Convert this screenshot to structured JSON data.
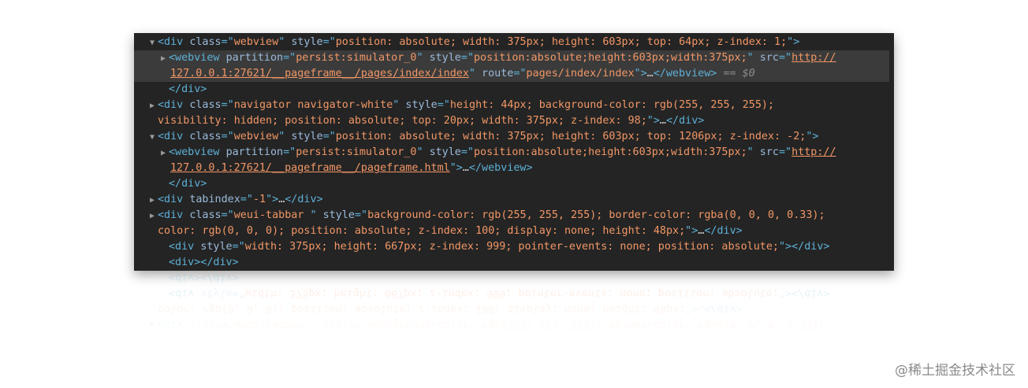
{
  "devtools": {
    "lines": [
      {
        "toggle": "▼",
        "segments": [
          {
            "cls": "tag",
            "text": "<div "
          },
          {
            "cls": "an",
            "text": "class"
          },
          {
            "cls": "tag",
            "text": "=\""
          },
          {
            "cls": "av",
            "text": "webview"
          },
          {
            "cls": "tag",
            "text": "\" "
          },
          {
            "cls": "an",
            "text": "style"
          },
          {
            "cls": "tag",
            "text": "=\""
          },
          {
            "cls": "av",
            "text": "position: absolute; width: 375px; height: 603px; top: 64px; z-index: 1;"
          },
          {
            "cls": "tag",
            "text": "\">"
          }
        ]
      },
      {
        "toggle": "▶",
        "segments": [
          {
            "cls": "tag",
            "text": "<webview "
          },
          {
            "cls": "an",
            "text": "partition"
          },
          {
            "cls": "tag",
            "text": "=\""
          },
          {
            "cls": "av",
            "text": "persist:simulator_0"
          },
          {
            "cls": "tag",
            "text": "\" "
          },
          {
            "cls": "an",
            "text": "style"
          },
          {
            "cls": "tag",
            "text": "=\""
          },
          {
            "cls": "av",
            "text": "position:absolute;height:603px;width:375px;"
          },
          {
            "cls": "tag",
            "text": "\" "
          },
          {
            "cls": "an",
            "text": "src"
          },
          {
            "cls": "tag",
            "text": "=\""
          },
          {
            "cls": "url",
            "text": "http://"
          }
        ]
      },
      {
        "toggle": "",
        "segments": [
          {
            "cls": "url",
            "text": "127.0.0.1:27621/__pageframe__/pages/index/index"
          },
          {
            "cls": "tag",
            "text": "\" "
          },
          {
            "cls": "an",
            "text": "route"
          },
          {
            "cls": "tag",
            "text": "=\""
          },
          {
            "cls": "av",
            "text": "pages/index/index"
          },
          {
            "cls": "tag",
            "text": "\">"
          },
          {
            "cls": "txt",
            "text": "…"
          },
          {
            "cls": "tag",
            "text": "</webview>"
          },
          {
            "cls": "dim",
            "text": " == $0"
          }
        ]
      },
      {
        "toggle": "",
        "segments": [
          {
            "cls": "tag",
            "text": "</div>"
          }
        ]
      },
      {
        "toggle": "▶",
        "segments": [
          {
            "cls": "tag",
            "text": "<div "
          },
          {
            "cls": "an",
            "text": "class"
          },
          {
            "cls": "tag",
            "text": "=\""
          },
          {
            "cls": "av",
            "text": "navigator navigator-white"
          },
          {
            "cls": "tag",
            "text": "\" "
          },
          {
            "cls": "an",
            "text": "style"
          },
          {
            "cls": "tag",
            "text": "=\""
          },
          {
            "cls": "av",
            "text": "height: 44px; background-color: rgb(255, 255, 255);"
          }
        ]
      },
      {
        "toggle": "",
        "segments": [
          {
            "cls": "av",
            "text": "visibility: hidden; position: absolute; top: 20px; width: 375px; z-index: 98;"
          },
          {
            "cls": "tag",
            "text": "\">"
          },
          {
            "cls": "txt",
            "text": "…"
          },
          {
            "cls": "tag",
            "text": "</div>"
          }
        ]
      },
      {
        "toggle": "▼",
        "segments": [
          {
            "cls": "tag",
            "text": "<div "
          },
          {
            "cls": "an",
            "text": "class"
          },
          {
            "cls": "tag",
            "text": "=\""
          },
          {
            "cls": "av",
            "text": "webview"
          },
          {
            "cls": "tag",
            "text": "\" "
          },
          {
            "cls": "an",
            "text": "style"
          },
          {
            "cls": "tag",
            "text": "=\""
          },
          {
            "cls": "av",
            "text": "position: absolute; width: 375px; height: 603px; top: 1206px; z-index: -2;"
          },
          {
            "cls": "tag",
            "text": "\">"
          }
        ]
      },
      {
        "toggle": "▶",
        "segments": [
          {
            "cls": "tag",
            "text": "<webview "
          },
          {
            "cls": "an",
            "text": "partition"
          },
          {
            "cls": "tag",
            "text": "=\""
          },
          {
            "cls": "av",
            "text": "persist:simulator_0"
          },
          {
            "cls": "tag",
            "text": "\" "
          },
          {
            "cls": "an",
            "text": "style"
          },
          {
            "cls": "tag",
            "text": "=\""
          },
          {
            "cls": "av",
            "text": "position:absolute;height:603px;width:375px;"
          },
          {
            "cls": "tag",
            "text": "\" "
          },
          {
            "cls": "an",
            "text": "src"
          },
          {
            "cls": "tag",
            "text": "=\""
          },
          {
            "cls": "url",
            "text": "http://"
          }
        ]
      },
      {
        "toggle": "",
        "segments": [
          {
            "cls": "url",
            "text": "127.0.0.1:27621/__pageframe__/pageframe.html"
          },
          {
            "cls": "tag",
            "text": "\">"
          },
          {
            "cls": "txt",
            "text": "…"
          },
          {
            "cls": "tag",
            "text": "</webview>"
          }
        ]
      },
      {
        "toggle": "",
        "segments": [
          {
            "cls": "tag",
            "text": "</div>"
          }
        ]
      },
      {
        "toggle": "▶",
        "segments": [
          {
            "cls": "tag",
            "text": "<div "
          },
          {
            "cls": "an",
            "text": "tabindex"
          },
          {
            "cls": "tag",
            "text": "=\""
          },
          {
            "cls": "av",
            "text": "-1"
          },
          {
            "cls": "tag",
            "text": "\">"
          },
          {
            "cls": "txt",
            "text": "…"
          },
          {
            "cls": "tag",
            "text": "</div>"
          }
        ]
      },
      {
        "toggle": "▶",
        "segments": [
          {
            "cls": "tag",
            "text": "<div "
          },
          {
            "cls": "an",
            "text": "class"
          },
          {
            "cls": "tag",
            "text": "=\""
          },
          {
            "cls": "av",
            "text": "weui-tabbar "
          },
          {
            "cls": "tag",
            "text": "\" "
          },
          {
            "cls": "an",
            "text": "style"
          },
          {
            "cls": "tag",
            "text": "=\""
          },
          {
            "cls": "av",
            "text": "background-color: rgb(255, 255, 255); border-color: rgba(0, 0, 0, 0.33);"
          }
        ]
      },
      {
        "toggle": "",
        "segments": [
          {
            "cls": "av",
            "text": "color: rgb(0, 0, 0); position: absolute; z-index: 100; display: none; height: 48px;"
          },
          {
            "cls": "tag",
            "text": "\">"
          },
          {
            "cls": "txt",
            "text": "…"
          },
          {
            "cls": "tag",
            "text": "</div>"
          }
        ]
      },
      {
        "toggle": "",
        "segments": [
          {
            "cls": "tag",
            "text": "<div "
          },
          {
            "cls": "an",
            "text": "style"
          },
          {
            "cls": "tag",
            "text": "=\""
          },
          {
            "cls": "av",
            "text": "width: 375px; height: 667px; z-index: 999; pointer-events: none; position: absolute;"
          },
          {
            "cls": "tag",
            "text": "\"></div>"
          }
        ]
      },
      {
        "toggle": "",
        "segments": [
          {
            "cls": "tag",
            "text": "<div></div>"
          }
        ]
      }
    ]
  },
  "watermark": "@稀土掘金技术社区"
}
